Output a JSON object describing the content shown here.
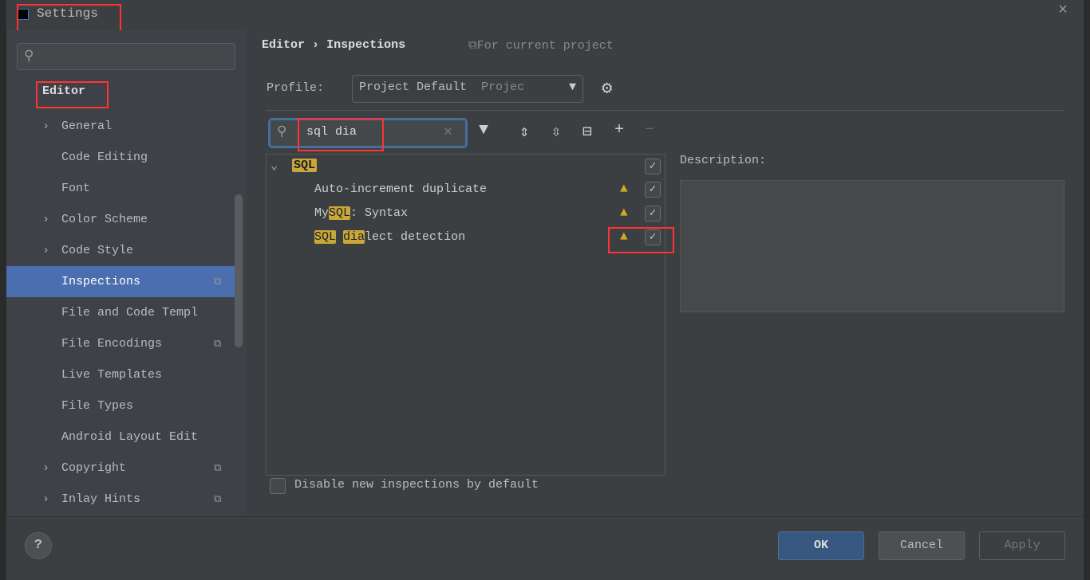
{
  "window": {
    "title": "Settings",
    "close": "×"
  },
  "sidebar": {
    "search_placeholder": "",
    "section": "Editor",
    "items": [
      {
        "label": "General",
        "expandable": true
      },
      {
        "label": "Code Editing"
      },
      {
        "label": "Font"
      },
      {
        "label": "Color Scheme",
        "expandable": true
      },
      {
        "label": "Code Style",
        "expandable": true
      },
      {
        "label": "Inspections",
        "selected": true,
        "project": true
      },
      {
        "label": "File and Code Templ"
      },
      {
        "label": "File Encodings",
        "project": true
      },
      {
        "label": "Live Templates"
      },
      {
        "label": "File Types"
      },
      {
        "label": "Android Layout Edit"
      },
      {
        "label": "Copyright",
        "expandable": true,
        "project": true
      },
      {
        "label": "Inlay Hints",
        "expandable": true,
        "project": true
      }
    ]
  },
  "main": {
    "breadcrumb": {
      "parent": "Editor",
      "sep": "›",
      "current": "Inspections"
    },
    "scope": "For current project",
    "profile": {
      "label": "Profile:",
      "value": "Project Default",
      "hint": "Projec"
    },
    "search": {
      "value": "sql dia"
    },
    "tree": {
      "group": "SQL",
      "items": [
        {
          "pre": "",
          "hl1": "",
          "mid": "Auto-increment duplicate",
          "hl2": "",
          "post": ""
        },
        {
          "pre": "My",
          "hl1": "SQL",
          "mid": ": Syntax",
          "hl2": "",
          "post": ""
        },
        {
          "pre": "",
          "hl1": "SQL",
          "mid": " ",
          "hl2": "dia",
          "post": "lect detection"
        }
      ]
    },
    "description_label": "Description:",
    "disable_new": "Disable new inspections by default"
  },
  "footer": {
    "help": "?",
    "ok": "OK",
    "cancel": "Cancel",
    "apply": "Apply"
  },
  "colors": {
    "accent": "#4b6eaf",
    "highlight": "#c9a83b",
    "warning": "#d4a62a",
    "annotation": "#ff3333"
  }
}
